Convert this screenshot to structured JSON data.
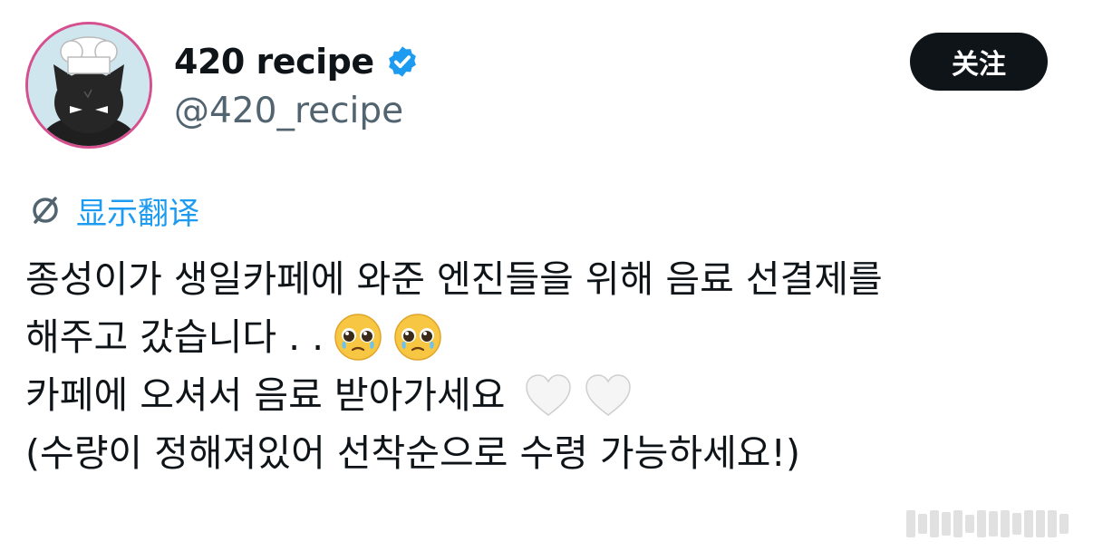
{
  "profile": {
    "display_name": "420 recipe",
    "handle": "@420_recipe",
    "verified": true
  },
  "follow_button": {
    "label": "关注"
  },
  "translate": {
    "label": "显示翻译"
  },
  "tweet": {
    "lines": [
      "종성이가 생일카페에 와준 엔진들을 위해 음료 선결제를",
      "해주고 갔습니다 . .",
      "카페에 오셔서 음료 받아가세요",
      "(수량이 정해져있어 선착순으로 수령 가능하세요!)"
    ],
    "emojis": {
      "line2": [
        "pleading-face-emoji",
        "pleading-face-emoji"
      ],
      "line3": [
        "white-heart-emoji",
        "white-heart-emoji"
      ]
    }
  },
  "colors": {
    "accent_blue": "#1d9bf0",
    "text_primary": "#0f1419",
    "text_secondary": "#536471",
    "button_bg": "#0f1419",
    "avatar_ring": "#d6508f",
    "avatar_bg": "#cfe6ee"
  }
}
